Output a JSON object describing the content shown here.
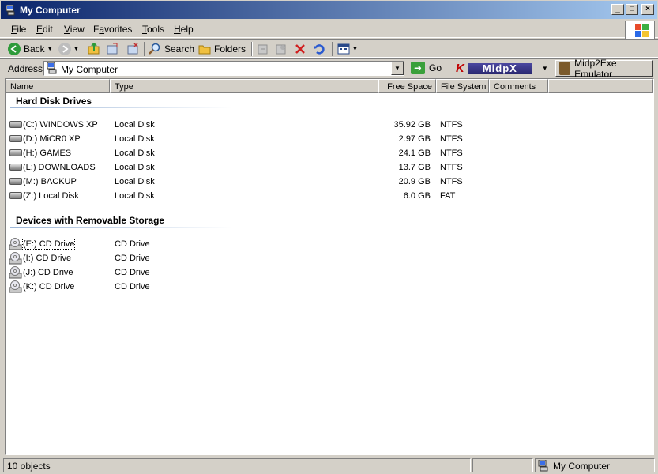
{
  "window": {
    "title": "My Computer",
    "controls": [
      "minimize",
      "maximize",
      "close"
    ]
  },
  "menu": [
    {
      "label": "File",
      "accel": "F",
      "rest": "ile"
    },
    {
      "label": "Edit",
      "accel": "E",
      "rest": "dit"
    },
    {
      "label": "View",
      "accel": "V",
      "rest": "iew"
    },
    {
      "label": "Favorites",
      "accel": "a",
      "pre": "F",
      "rest": "vorites"
    },
    {
      "label": "Tools",
      "accel": "T",
      "rest": "ools"
    },
    {
      "label": "Help",
      "accel": "H",
      "rest": "elp"
    }
  ],
  "toolbar": {
    "back_label": "Back",
    "search_label": "Search",
    "folders_label": "Folders"
  },
  "address": {
    "label": "Address",
    "value": "My Computer",
    "go_label": "Go",
    "midpx_logo": "MidpX",
    "emulator_label": "Midp2Exe Emulator"
  },
  "columns": [
    "Name",
    "Type",
    "Free Space",
    "File System",
    "Comments"
  ],
  "groups": {
    "hard_disks": {
      "title": "Hard Disk Drives",
      "items": [
        {
          "name": "(C:) WINDOWS XP",
          "type": "Local Disk",
          "free": "35.92 GB",
          "fs": "NTFS"
        },
        {
          "name": "(D:) MiCR0 XP",
          "type": "Local Disk",
          "free": "2.97 GB",
          "fs": "NTFS"
        },
        {
          "name": "(H:) GAMES",
          "type": "Local Disk",
          "free": "24.1 GB",
          "fs": "NTFS"
        },
        {
          "name": "(L:) DOWNLOADS",
          "type": "Local Disk",
          "free": "13.7 GB",
          "fs": "NTFS"
        },
        {
          "name": "(M:) BACKUP",
          "type": "Local Disk",
          "free": "20.9 GB",
          "fs": "NTFS"
        },
        {
          "name": "(Z:) Local Disk",
          "type": "Local Disk",
          "free": "6.0 GB",
          "fs": "FAT"
        }
      ]
    },
    "removable": {
      "title": "Devices with Removable Storage",
      "items": [
        {
          "name": "(E:) CD Drive",
          "type": "CD Drive"
        },
        {
          "name": "(I:) CD Drive",
          "type": "CD Drive"
        },
        {
          "name": "(J:) CD Drive",
          "type": "CD Drive"
        },
        {
          "name": "(K:) CD Drive",
          "type": "CD Drive"
        }
      ]
    }
  },
  "status": {
    "count": "10 objects",
    "location": "My Computer"
  }
}
